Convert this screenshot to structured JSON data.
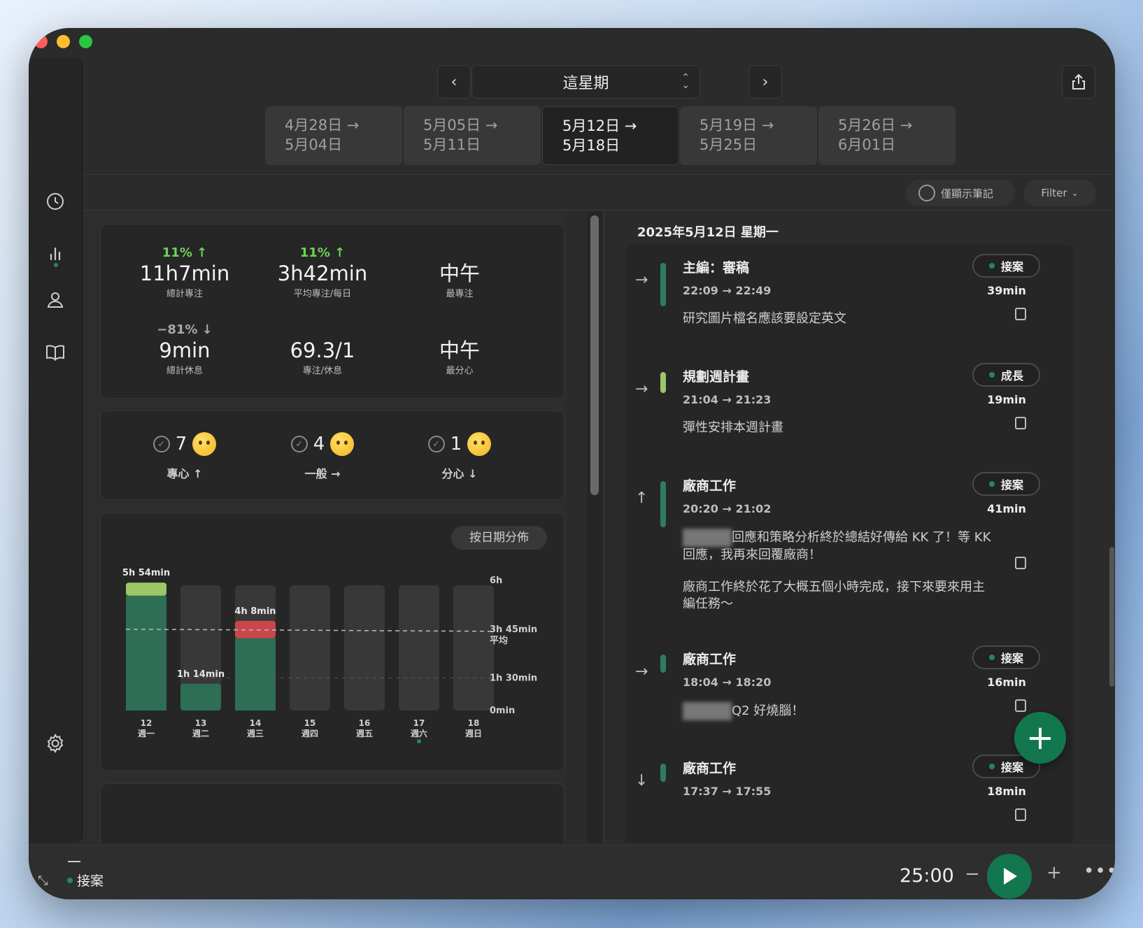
{
  "header": {
    "period": "這星期",
    "weeks": [
      {
        "line1": "4月28日 →",
        "line2": "5月04日"
      },
      {
        "line1": "5月05日 →",
        "line2": "5月11日"
      },
      {
        "line1": "5月12日 →",
        "line2": "5月18日"
      },
      {
        "line1": "5月19日 →",
        "line2": "5月25日"
      },
      {
        "line1": "5月26日 →",
        "line2": "6月01日"
      }
    ],
    "active_week_index": 2
  },
  "filters": {
    "notes_only": "僅顯示筆記",
    "filter": "Filter"
  },
  "stats": [
    {
      "pct": "11% ↑",
      "value": "11h7min",
      "label": "總計專注",
      "pct_color": "#6cd45a"
    },
    {
      "pct": "11% ↑",
      "value": "3h42min",
      "label": "平均專注/每日",
      "pct_color": "#6cd45a"
    },
    {
      "pct": "",
      "value": "中午",
      "label": "最專注"
    },
    {
      "pct": "−81% ↓",
      "value": "9min",
      "label": "總計休息",
      "pct_color": "#a8a8a8"
    },
    {
      "pct": "",
      "value": "69.3/1",
      "label": "專注/休息"
    },
    {
      "pct": "",
      "value": "中午",
      "label": "最分心"
    }
  ],
  "moods": [
    {
      "count": "7",
      "label": "專心 ↑",
      "emoji": "star-struck"
    },
    {
      "count": "4",
      "label": "一般 →",
      "emoji": "slight-smile"
    },
    {
      "count": "1",
      "label": "分心 ↓",
      "emoji": "pensive"
    }
  ],
  "chart_toggle": "按日期分佈",
  "chart_data": {
    "type": "bar",
    "categories": [
      "12",
      "13",
      "14",
      "15",
      "16",
      "17",
      "18"
    ],
    "weekdays": [
      "週一",
      "週二",
      "週三",
      "週四",
      "週五",
      "週六",
      "週日"
    ],
    "total_minutes": [
      354,
      74,
      248,
      0,
      0,
      0,
      0
    ],
    "segments": [
      [
        {
          "value": 318,
          "color": "#2e6e55"
        },
        {
          "value": 36,
          "color": "#9cc667"
        }
      ],
      [
        {
          "value": 74,
          "color": "#2e6e55"
        }
      ],
      [
        {
          "value": 200,
          "color": "#2e6e55"
        },
        {
          "value": 48,
          "color": "#c9474a"
        }
      ],
      [],
      [],
      [],
      []
    ],
    "bar_labels": [
      "5h 54min",
      "1h 14min",
      "4h 8min",
      "",
      "",
      "",
      ""
    ],
    "y_ticks": [
      {
        "value": 360,
        "label": "6h"
      },
      {
        "value": 225,
        "label": "3h 45min",
        "sub": "平均"
      },
      {
        "value": 90,
        "label": "1h 30min"
      },
      {
        "value": 0,
        "label": "0min"
      }
    ],
    "average": 225,
    "ylim": [
      0,
      360
    ],
    "today_index": 5
  },
  "timeline": {
    "date": "2025年5月12日 星期一",
    "entries": [
      {
        "arrow": "→",
        "title": "主編：審稿",
        "time": "22:09 → 22:49",
        "tag": "接案",
        "duration": "39min",
        "note": "研究圖片檔名應該要設定英文",
        "bar_color": "#2e7d5e"
      },
      {
        "arrow": "→",
        "title": "規劃週計畫",
        "time": "21:04 → 21:23",
        "tag": "成長",
        "duration": "19min",
        "note": "彈性安排本週計畫",
        "bar_color": "#9cc667"
      },
      {
        "arrow": "↑",
        "title": "廠商工作",
        "time": "20:20 → 21:02",
        "tag": "接案",
        "duration": "41min",
        "note": "回應和策略分析終於總結好傳給 KK 了！等 KK 回應，我再來回覆廠商！",
        "note2": "廠商工作終於花了大概五個小時完成，接下來要來用主編任務～",
        "bar_color": "#2e7d5e"
      },
      {
        "arrow": "→",
        "title": "廠商工作",
        "time": "18:04 → 18:20",
        "tag": "接案",
        "duration": "16min",
        "note": "Q2 好燒腦！",
        "bar_color": "#2e7d5e"
      },
      {
        "arrow": "↓",
        "title": "廠商工作",
        "time": "17:37 → 17:55",
        "tag": "接案",
        "duration": "18min",
        "note": "",
        "bar_color": "#2e7d5e"
      }
    ]
  },
  "footer": {
    "task": "接案",
    "timer": "25:00",
    "minus": "−",
    "plus": "+",
    "more": "•••"
  }
}
